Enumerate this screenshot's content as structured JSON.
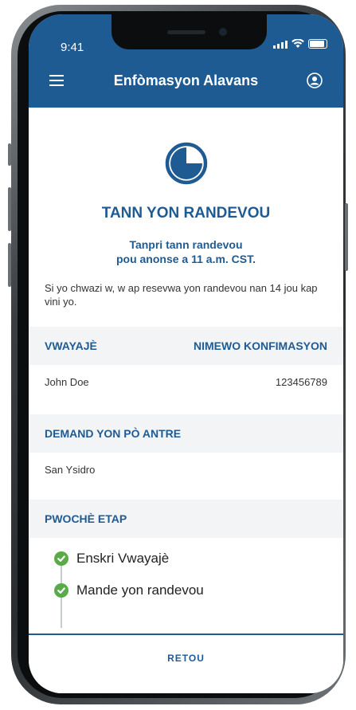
{
  "status_bar": {
    "time": "9:41"
  },
  "header": {
    "title": "Enfòmasyon Alavans"
  },
  "main": {
    "heading": "TANN YON RANDEVOU",
    "sub_line1": "Tanpri tann randevou",
    "sub_line2": "pou anonse a 11 a.m. CST.",
    "note": "Si yo chwazi w, w ap resevwa yon randevou nan 14 jou kap vini yo."
  },
  "traveler": {
    "col1_header": "VWAYAJÈ",
    "col2_header": "NIMEWO KONFIMASYON",
    "name": "John Doe",
    "confirmation": "123456789"
  },
  "entry_request": {
    "header": "DEMAND YON PÒ ANTRE",
    "value": "San Ysidro"
  },
  "next_steps": {
    "header": "PWOCHÈ ETAP",
    "steps": [
      {
        "label": "Enskri Vwayajè"
      },
      {
        "label": "Mande yon randevou"
      }
    ]
  },
  "footer": {
    "back_label": "RETOU"
  },
  "colors": {
    "brand_blue": "#1f5b93",
    "success_green": "#5aaa4a",
    "section_bg": "#f2f4f6"
  }
}
